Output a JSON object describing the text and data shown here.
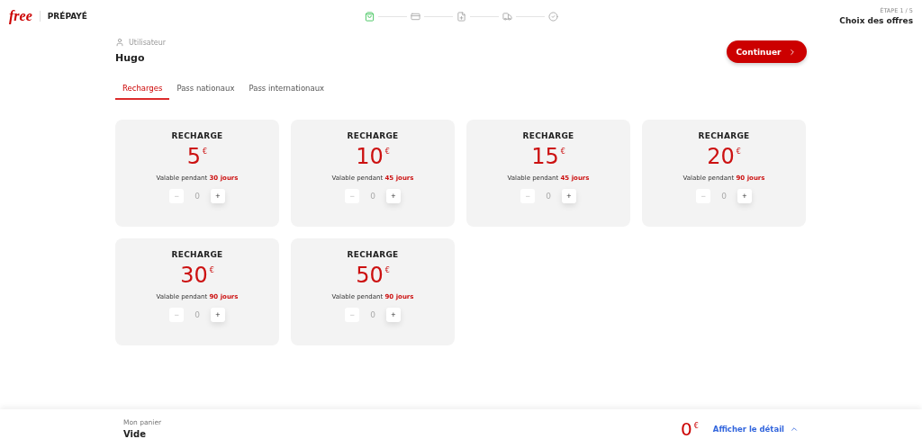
{
  "header": {
    "logo": "free",
    "product": "PRÉPAYÉ",
    "steps": [
      {
        "selected": true
      },
      {
        "selected": false
      },
      {
        "selected": false
      },
      {
        "selected": false
      },
      {
        "selected": false
      }
    ],
    "step_label": "ÉTAPE 1 / 5",
    "step_title": "Choix des offres"
  },
  "user": {
    "label": "Utilisateur",
    "name": "Hugo"
  },
  "continue_button": "Continuer",
  "tabs": [
    {
      "label": "Recharges",
      "selected": true
    },
    {
      "label": "Pass nationaux",
      "selected": false
    },
    {
      "label": "Pass internationaux",
      "selected": false
    }
  ],
  "offers": [
    {
      "title": "RECHARGE",
      "amount": "5",
      "currency": "€",
      "validity": "Valable pendant",
      "duration": "30 jours",
      "minus": "−",
      "quantity": "0",
      "plus": "+",
      "minus_disabled": true
    },
    {
      "title": "RECHARGE",
      "amount": "10",
      "currency": "€",
      "validity": "Valable pendant",
      "duration": "45 jours",
      "minus": "−",
      "quantity": "0",
      "plus": "+",
      "minus_disabled": true
    },
    {
      "title": "RECHARGE",
      "amount": "15",
      "currency": "€",
      "validity": "Valable pendant",
      "duration": "45 jours",
      "minus": "−",
      "quantity": "0",
      "plus": "+",
      "minus_disabled": true
    },
    {
      "title": "RECHARGE",
      "amount": "20",
      "currency": "€",
      "validity": "Valable pendant",
      "duration": "90 jours",
      "minus": "−",
      "quantity": "0",
      "plus": "+",
      "minus_disabled": true
    },
    {
      "title": "RECHARGE",
      "amount": "30",
      "currency": "€",
      "validity": "Valable pendant",
      "duration": "90 jours",
      "minus": "−",
      "quantity": "0",
      "plus": "+",
      "minus_disabled": true
    },
    {
      "title": "RECHARGE",
      "amount": "50",
      "currency": "€",
      "validity": "Valable pendant",
      "duration": "90 jours",
      "minus": "−",
      "quantity": "0",
      "plus": "+",
      "minus_disabled": true
    }
  ],
  "cart": {
    "label": "Mon panier",
    "status": "Vide",
    "total": "0",
    "currency": "€",
    "detail_link": "Afficher le détail"
  }
}
